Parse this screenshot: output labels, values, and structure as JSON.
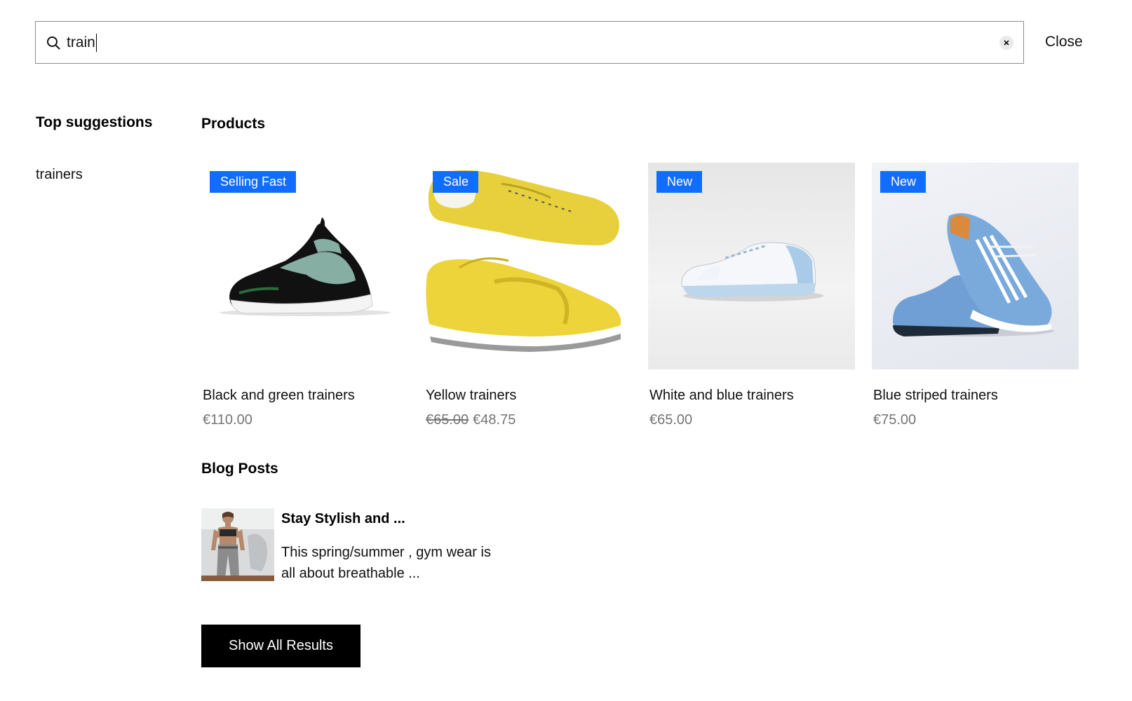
{
  "search": {
    "value": "train",
    "placeholder": "Search...",
    "close_label": "Close"
  },
  "suggestions": {
    "title": "Top suggestions",
    "items": [
      {
        "label": "trainers"
      }
    ]
  },
  "products": {
    "title": "Products",
    "items": [
      {
        "badge": "Selling Fast",
        "name": "Black and green trainers",
        "price": "€110.00",
        "old_price": "",
        "image": "black-green-sneaker"
      },
      {
        "badge": "Sale",
        "name": "Yellow trainers",
        "price": "€48.75",
        "old_price": "€65.00",
        "image": "yellow-sneakers"
      },
      {
        "badge": "New",
        "name": "White and blue trainers",
        "price": "€65.00",
        "old_price": "",
        "image": "white-blue-sneakers"
      },
      {
        "badge": "New",
        "name": "Blue striped trainers",
        "price": "€75.00",
        "old_price": "",
        "image": "blue-striped-sneakers"
      }
    ]
  },
  "blog": {
    "title": "Blog Posts",
    "posts": [
      {
        "title": "Stay Stylish and ...",
        "excerpt": "This spring/summer , gym wear is all about breathable ...",
        "image": "woman-gym-wear"
      }
    ]
  },
  "show_all_label": "Show All Results",
  "colors": {
    "badge": "#116dff",
    "button": "#000000",
    "price": "#757575",
    "border": "#8c8c8c"
  }
}
